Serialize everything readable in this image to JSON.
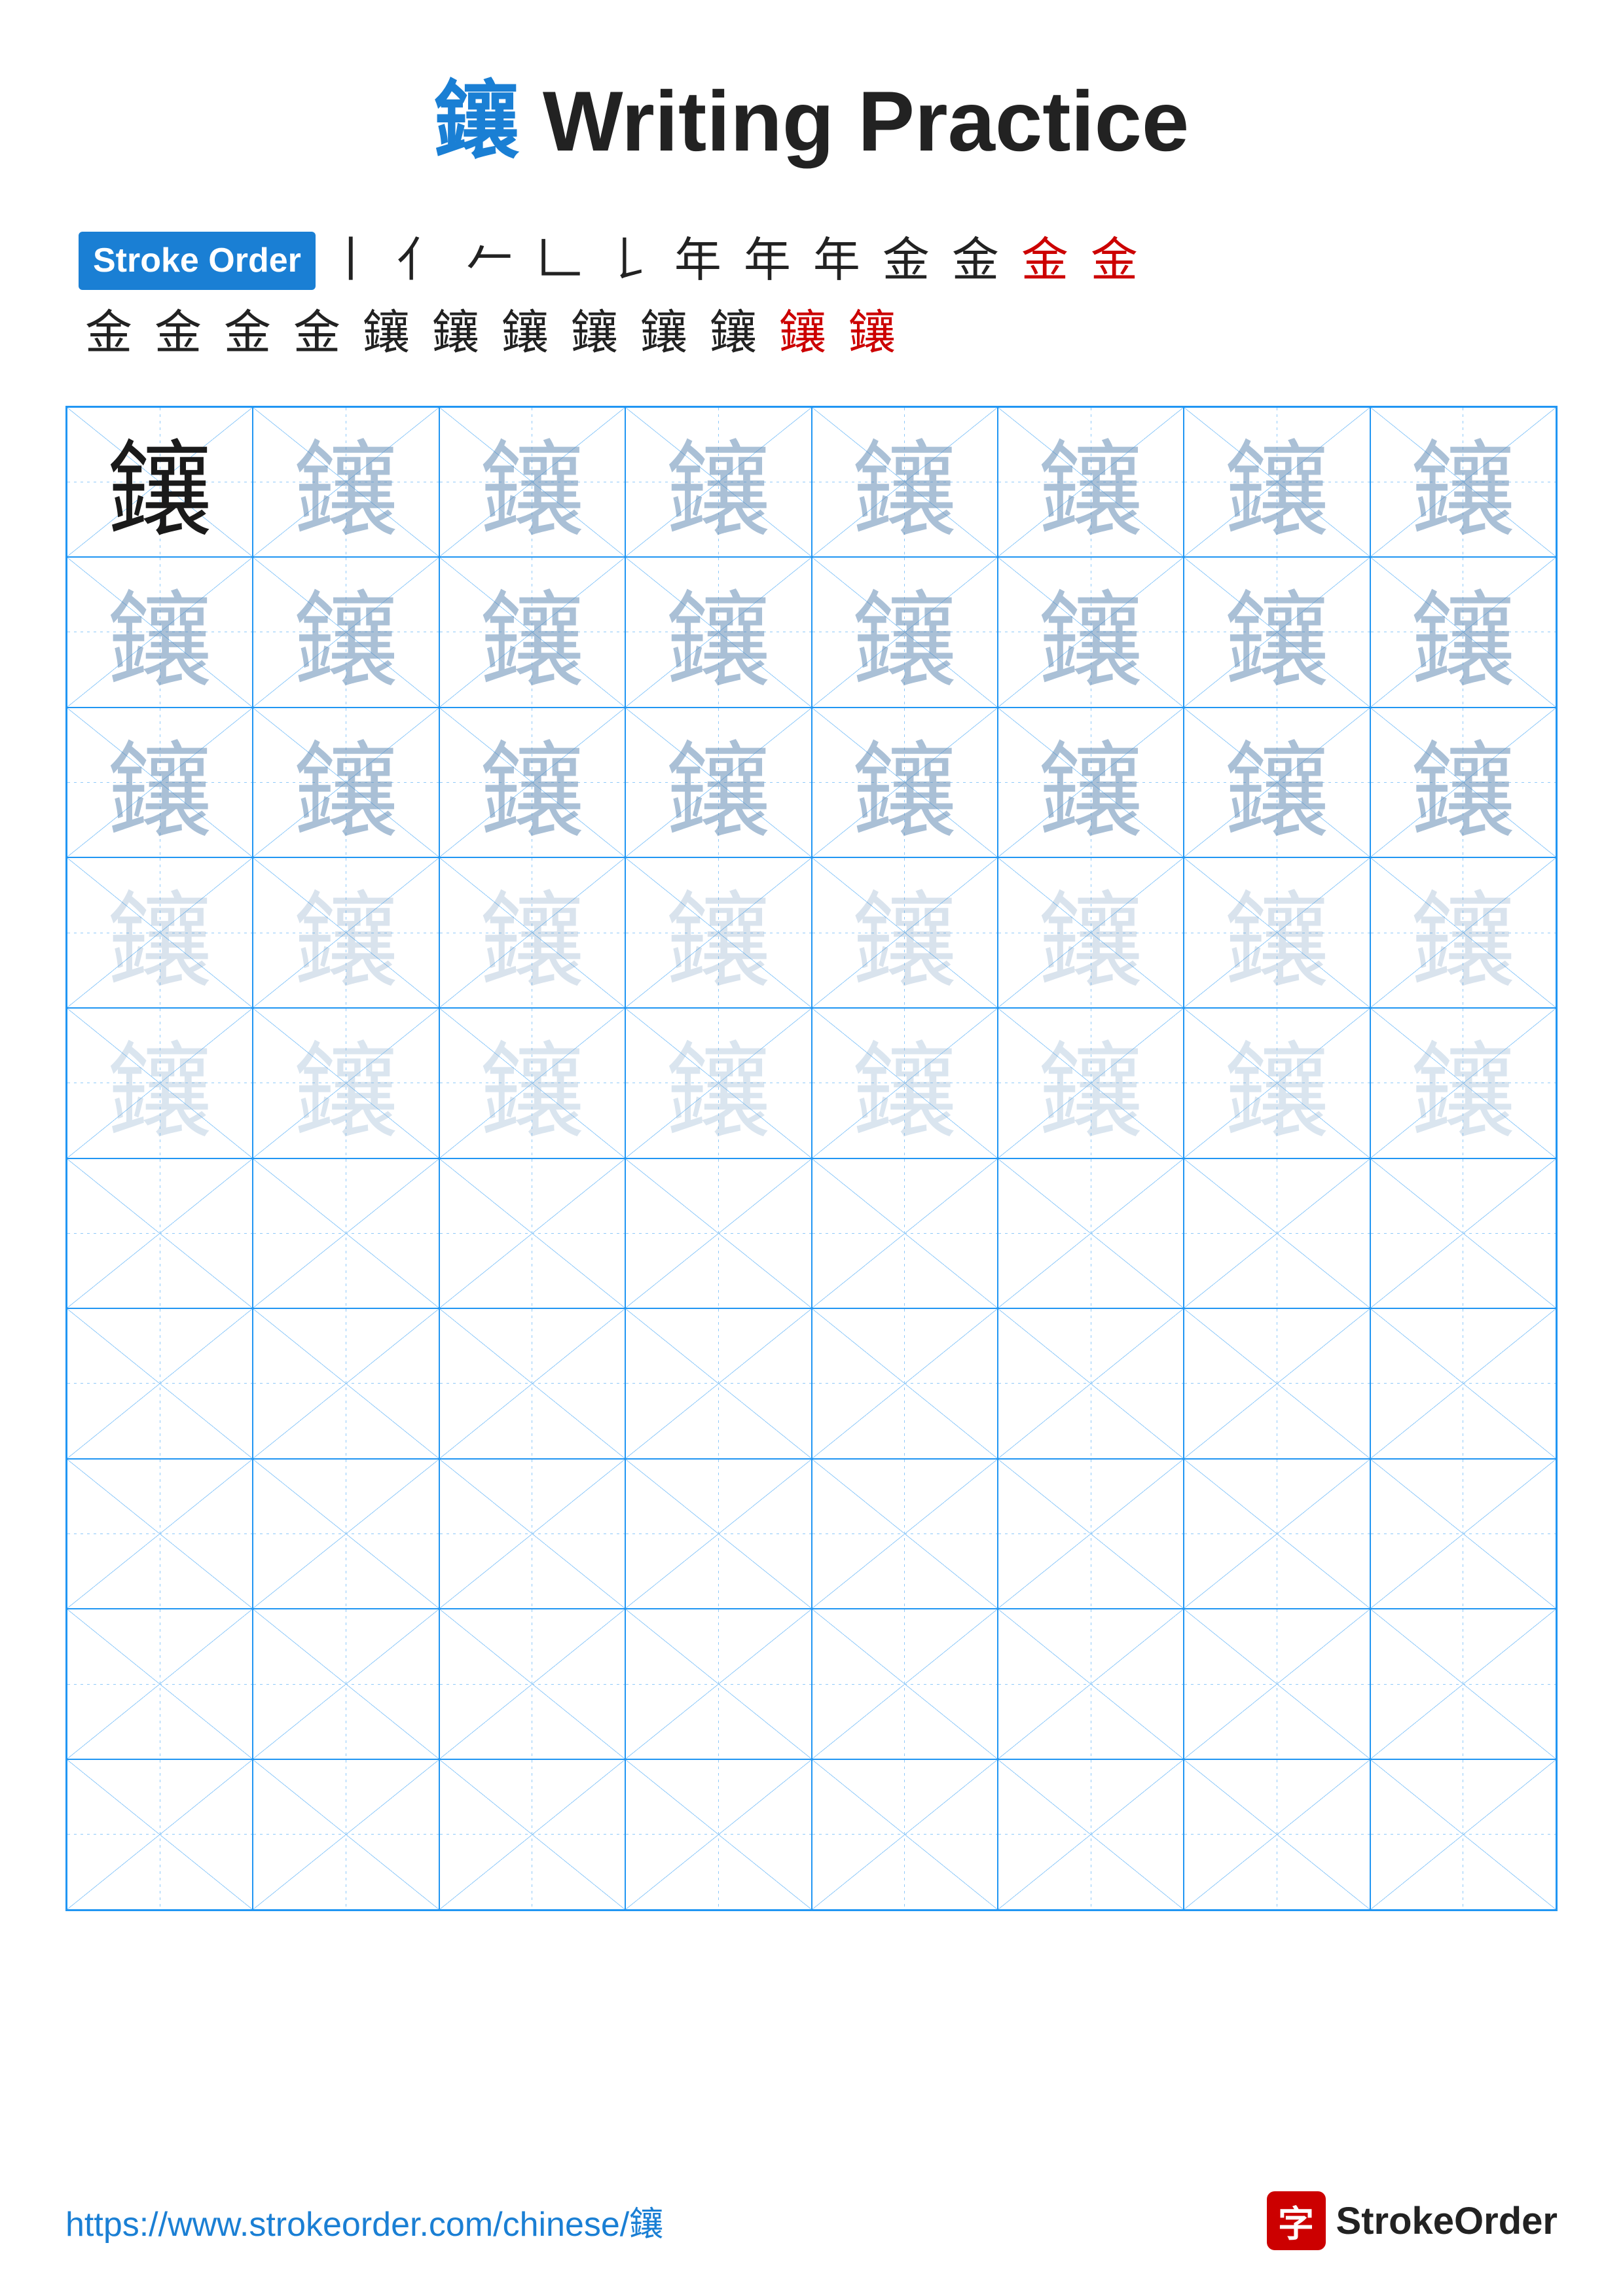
{
  "title": {
    "char": "鑲",
    "text": " Writing Practice"
  },
  "stroke_order": {
    "badge_label": "Stroke Order",
    "line1_strokes": "丨 亻 𠂉 𠃊 𠄌 年 年 年 金 金 金 金",
    "line2_strokes": "金 金 金 金 鑲 鑲 鑲 鑲 鑲 鑲 鑲 鑲"
  },
  "practice_char": "鑲",
  "grid": {
    "cols": 8,
    "rows": 10,
    "filled_rows": 5,
    "shading": [
      "dark",
      "medium",
      "medium",
      "medium",
      "light"
    ]
  },
  "footer": {
    "url": "https://www.strokeorder.com/chinese/鑲",
    "logo_char": "字",
    "logo_text": "StrokeOrder"
  }
}
